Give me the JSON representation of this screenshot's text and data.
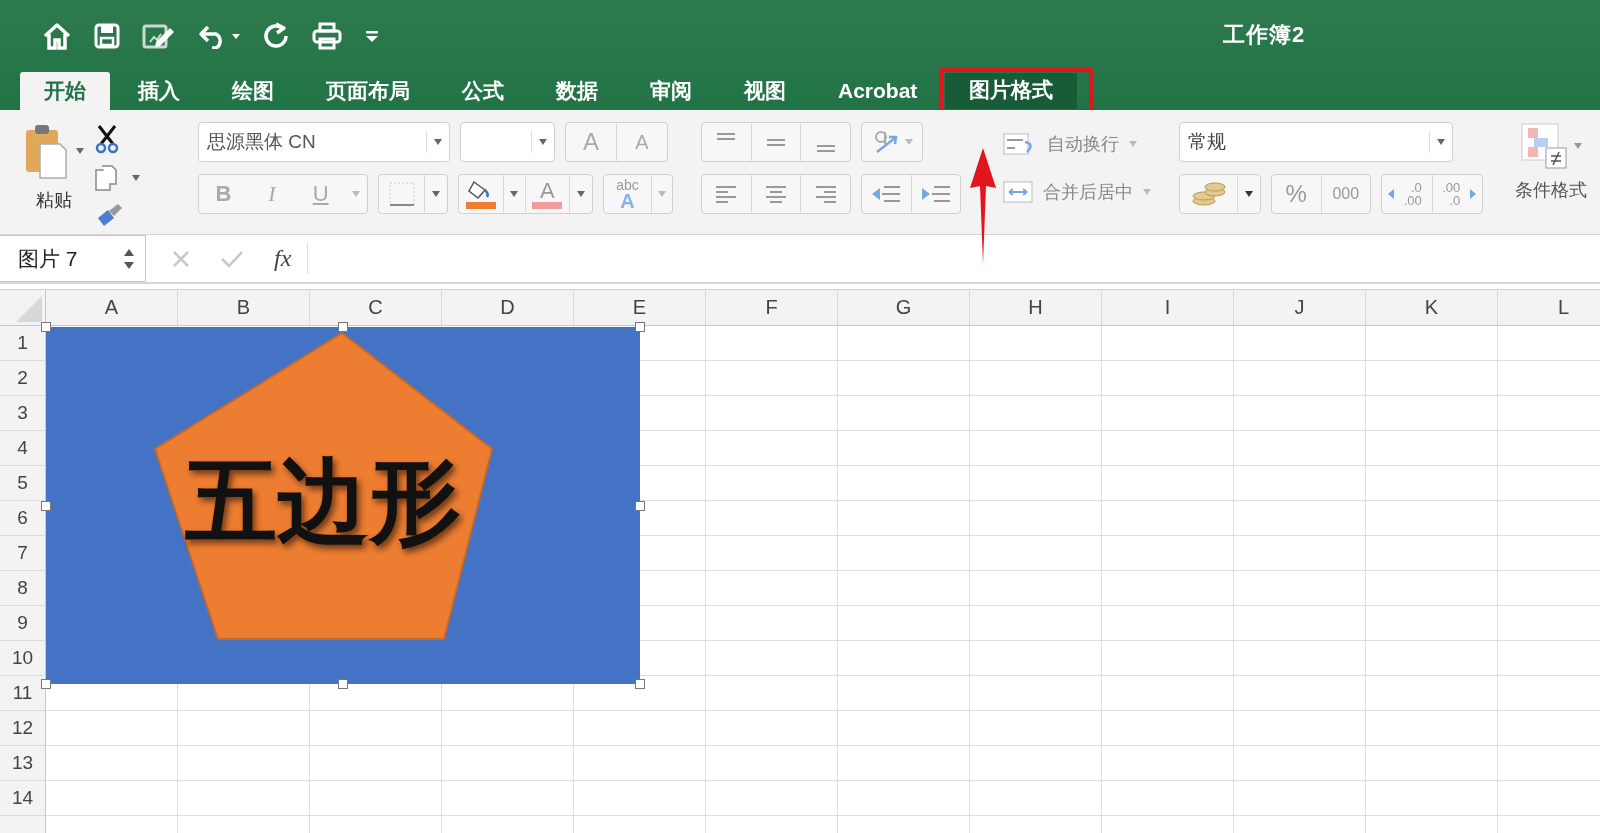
{
  "window": {
    "title": "工作簿2"
  },
  "tabs": [
    {
      "label": "开始",
      "selected": true,
      "contextual": false,
      "annotated": false
    },
    {
      "label": "插入",
      "selected": false,
      "contextual": false,
      "annotated": false
    },
    {
      "label": "绘图",
      "selected": false,
      "contextual": false,
      "annotated": false
    },
    {
      "label": "页面布局",
      "selected": false,
      "contextual": false,
      "annotated": false
    },
    {
      "label": "公式",
      "selected": false,
      "contextual": false,
      "annotated": false
    },
    {
      "label": "数据",
      "selected": false,
      "contextual": false,
      "annotated": false
    },
    {
      "label": "审阅",
      "selected": false,
      "contextual": false,
      "annotated": false
    },
    {
      "label": "视图",
      "selected": false,
      "contextual": false,
      "annotated": false
    },
    {
      "label": "Acrobat",
      "selected": false,
      "contextual": false,
      "annotated": false
    },
    {
      "label": "图片格式",
      "selected": false,
      "contextual": true,
      "annotated": true
    }
  ],
  "ribbon": {
    "paste": "粘贴",
    "font_name": "思源黑体 CN",
    "grow_font": "A",
    "shrink_font": "A",
    "bold": "B",
    "italic": "I",
    "underline": "U",
    "font_color": "A",
    "phonetic": [
      "abc",
      "A"
    ],
    "wrap_text": "自动换行",
    "merge_center": "合并后居中",
    "number_format": "常规",
    "percent": "%",
    "thousands": "000",
    "increase_decimal": [
      ".0",
      ".00"
    ],
    "decrease_decimal": [
      ".00",
      ".0"
    ],
    "conditional_format": "条件格式"
  },
  "formula_bar": {
    "name_box": "图片 7",
    "function": "fx"
  },
  "sheet": {
    "columns": [
      "A",
      "B",
      "C",
      "D",
      "E",
      "F",
      "G",
      "H",
      "I",
      "J",
      "K",
      "L"
    ],
    "rows": [
      "1",
      "2",
      "3",
      "4",
      "5",
      "6",
      "7",
      "8",
      "9",
      "10",
      "11",
      "12",
      "13",
      "14"
    ],
    "picture": {
      "text": "五边形"
    }
  }
}
